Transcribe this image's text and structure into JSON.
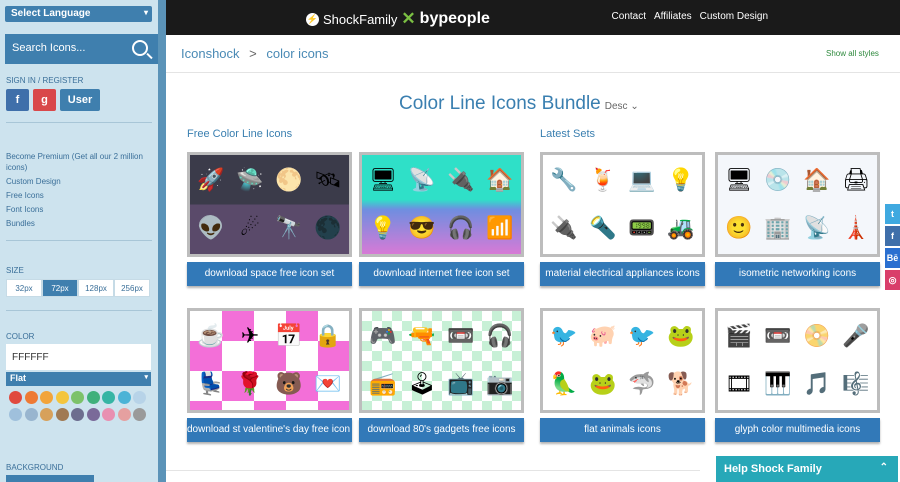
{
  "sidebar": {
    "language_select": "Select Language",
    "search_placeholder": "Search Icons...",
    "signin_label": "SIGN IN / REGISTER",
    "fb_label": "f",
    "gp_label": "g",
    "user_label": "User",
    "links": [
      "Become Premium (Get all our 2 million icons)",
      "Custom Design",
      "Free Icons",
      "Font Icons",
      "Bundles"
    ],
    "size_label": "SIZE",
    "sizes": [
      "32px",
      "72px",
      "128px",
      "256px"
    ],
    "size_active": "72px",
    "color_label": "COLOR",
    "color_value": "FFFFFF",
    "style_select": "Flat",
    "swatch_colors": [
      "#e04a3f",
      "#ee7a35",
      "#f2a43a",
      "#f4c53d",
      "#7cc26a",
      "#3fb07b",
      "#35b5a4",
      "#4bb3d6",
      "#b7d3e8",
      "#9fc0dc",
      "#98b5cf",
      "#d7a15b",
      "#a07a53",
      "#6d6e8f",
      "#7a6a99",
      "#e890b1",
      "#e5a0a0",
      "#9a9a9a"
    ],
    "background_label": "BACKGROUND"
  },
  "topbar": {
    "brand_shock": "ShockFamily",
    "brand_bypeople": "bypeople",
    "links": [
      "Contact",
      "Affiliates",
      "Custom Design"
    ]
  },
  "breadcrumb": {
    "root": "Iconshock",
    "sep": ">",
    "current": "color icons"
  },
  "show_all": "Show all styles",
  "title": "Color Line Icons Bundle",
  "sort": "Desc",
  "sections": {
    "left": "Free Color Line Icons",
    "right": "Latest Sets"
  },
  "cards": [
    {
      "label": "download space free icon set",
      "icons": [
        "🚀",
        "🛸",
        "🌕",
        "🛰",
        "👽",
        "☄",
        "🔭",
        "🌑"
      ],
      "icon_names": [
        "rocket-icon",
        "ufo-icon",
        "planet-icon",
        "satellite-icon",
        "alien-icon",
        "comet-icon",
        "telescope-icon",
        "moon-icon"
      ]
    },
    {
      "label": "download internet free icon set",
      "icons": [
        "🖥",
        "📡",
        "🔌",
        "🏠",
        "💡",
        "😎",
        "🎧",
        "📶"
      ],
      "icon_names": [
        "monitor-icon",
        "router-icon",
        "plug-icon",
        "home-icon",
        "bulb-icon",
        "face-icon",
        "headphones-icon",
        "signal-icon"
      ]
    },
    {
      "label": "material electrical appliances icons",
      "icons": [
        "🔧",
        "🍹",
        "💻",
        "💡",
        "🔌",
        "🔦",
        "📟",
        "🚜"
      ],
      "icon_names": [
        "tool-icon",
        "blender-icon",
        "laptop-icon",
        "lamp-icon",
        "socket-icon",
        "flashlight-icon",
        "device-icon",
        "machine-icon"
      ]
    },
    {
      "label": "isometric networking icons",
      "icons": [
        "🖥",
        "💿",
        "🏠",
        "🖨",
        "🙂",
        "🏢",
        "📡",
        "🗼"
      ],
      "icon_names": [
        "server-icon",
        "disc-icon",
        "house-icon",
        "printer-icon",
        "smiley-icon",
        "building-icon",
        "antenna-icon",
        "tower-icon"
      ]
    },
    {
      "label": "download st valentine's day free icon set",
      "icons": [
        "☕",
        "✈",
        "📅",
        "🔒",
        "💺",
        "🌹",
        "🐻",
        "💌"
      ],
      "icon_names": [
        "cup-icon",
        "plane-icon",
        "calendar-icon",
        "lock-icon",
        "chair-icon",
        "roses-icon",
        "bear-icon",
        "letter-icon"
      ]
    },
    {
      "label": "download 80's gadgets free icons",
      "icons": [
        "🎮",
        "🔫",
        "📼",
        "🎧",
        "📻",
        "🕹",
        "📺",
        "📷"
      ],
      "icon_names": [
        "gamepad-icon",
        "gun-icon",
        "cassette-icon",
        "headphones-icon",
        "radio-icon",
        "joystick-icon",
        "tv-icon",
        "camera-icon"
      ]
    },
    {
      "label": "flat animals icons",
      "icons": [
        "🐦",
        "🐖",
        "🐦",
        "🐸",
        "🦜",
        "🐸",
        "🦈",
        "🐕"
      ],
      "icon_names": [
        "bird-icon",
        "pig-icon",
        "woodpecker-icon",
        "frog-icon",
        "parrot-icon",
        "toad-icon",
        "shark-icon",
        "dog-icon"
      ]
    },
    {
      "label": "glyph color multimedia icons",
      "icons": [
        "🎬",
        "📼",
        "📀",
        "🎤",
        "🎞",
        "🎹",
        "🎵",
        "🎼"
      ],
      "icon_names": [
        "video-icon",
        "tape-icon",
        "disc-icon",
        "microphone-icon",
        "film-icon",
        "keyboard-icon",
        "music-icon",
        "clef-icon"
      ]
    }
  ],
  "social": [
    {
      "label": "t",
      "color": "#3fa9e0",
      "name": "twitter-icon"
    },
    {
      "label": "f",
      "color": "#3f6faa",
      "name": "facebook-icon"
    },
    {
      "label": "Bē",
      "color": "#2a6fd0",
      "name": "behance-icon"
    },
    {
      "label": "◎",
      "color": "#d93e6a",
      "name": "instagram-icon"
    }
  ],
  "help_bar": "Help Shock Family"
}
